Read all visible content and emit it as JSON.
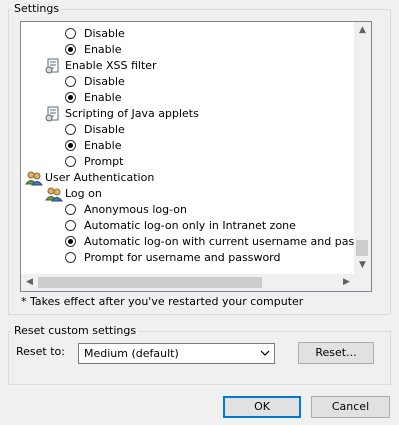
{
  "settings": {
    "title": "Settings",
    "items": [
      {
        "type": "radio",
        "label": "Disable",
        "checked": false
      },
      {
        "type": "radio",
        "label": "Enable",
        "checked": true
      },
      {
        "type": "heading",
        "label": "Enable XSS filter",
        "icon": "document-settings-icon"
      },
      {
        "type": "radio",
        "label": "Disable",
        "checked": false
      },
      {
        "type": "radio",
        "label": "Enable",
        "checked": true
      },
      {
        "type": "heading",
        "label": "Scripting of Java applets",
        "icon": "document-settings-icon"
      },
      {
        "type": "radio",
        "label": "Disable",
        "checked": false
      },
      {
        "type": "radio",
        "label": "Enable",
        "checked": true
      },
      {
        "type": "radio",
        "label": "Prompt",
        "checked": false
      },
      {
        "type": "category",
        "label": "User Authentication",
        "icon": "users-icon"
      },
      {
        "type": "subcategory",
        "label": "Log on",
        "icon": "users-icon"
      },
      {
        "type": "radio",
        "label": "Anonymous log-on",
        "checked": false
      },
      {
        "type": "radio",
        "label": "Automatic log-on only in Intranet zone",
        "checked": false
      },
      {
        "type": "radio",
        "label": "Automatic log-on with current username and password",
        "checked": true
      },
      {
        "type": "radio",
        "label": "Prompt for username and password",
        "checked": false
      }
    ],
    "note": "* Takes effect after you've restarted your computer"
  },
  "reset": {
    "title": "Reset custom settings",
    "reset_to_label": "Reset to:",
    "selected": "Medium (default)",
    "button": "Reset..."
  },
  "dialog": {
    "ok": "OK",
    "cancel": "Cancel"
  }
}
